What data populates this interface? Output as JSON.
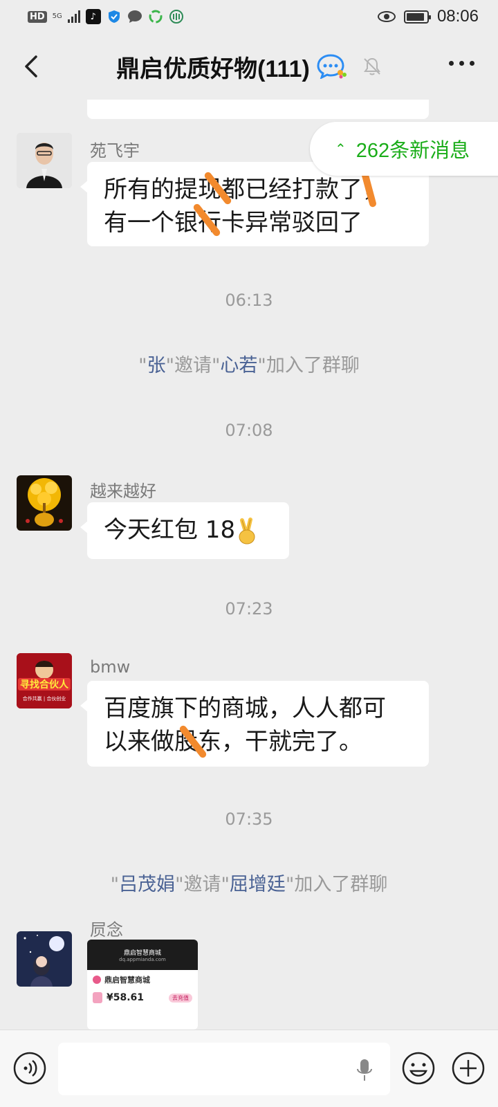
{
  "status_bar": {
    "left_label": "HD",
    "network": "5G",
    "time": "08:06",
    "battery_level": 0.9,
    "icons": [
      "tiktok-icon",
      "shield-icon",
      "message-icon",
      "recycle-icon",
      "bank-icon"
    ]
  },
  "header": {
    "title": "鼎启优质好物(111)",
    "icons": [
      "back-icon",
      "group-badge-icon",
      "mute-bell-icon",
      "more-icon"
    ]
  },
  "new_messages": {
    "label": "262条新消息"
  },
  "messages": [
    {
      "type": "text",
      "sender": "",
      "text": "…",
      "cut": true
    },
    {
      "type": "text",
      "sender": "苑飞宇",
      "lines": [
        "所有的提现都已经打款了，",
        "有一个银行卡异常驳回了"
      ]
    },
    {
      "type": "time",
      "text": "06:13"
    },
    {
      "type": "system",
      "parts": [
        "\"",
        "张",
        "\"邀请\"",
        "心若",
        "\"加入了群聊"
      ]
    },
    {
      "type": "time",
      "text": "07:08"
    },
    {
      "type": "text",
      "sender": "越来越好",
      "text": "今天红包 18",
      "emoji": "victory-hand-emoji"
    },
    {
      "type": "time",
      "text": "07:23"
    },
    {
      "type": "text",
      "sender": "bmw",
      "lines": [
        "百度旗下的商城，人人都可",
        "以来做股东，干就完了。"
      ]
    },
    {
      "type": "time",
      "text": "07:35"
    },
    {
      "type": "system",
      "parts": [
        "\"",
        "吕茂娟",
        "\"邀请\"",
        "屈增廷",
        "\"加入了群聊"
      ]
    },
    {
      "type": "image",
      "sender": "屃念",
      "preview": {
        "app_title": "鼎启智慧商城",
        "url": "dq.appmianda.com",
        "shop_name": "鼎启智慧商城",
        "amount": "¥58.61",
        "button": "去充值"
      }
    }
  ],
  "avatars": {
    "avatar_1_label": "",
    "avatar_3_text": "寻找合伙人",
    "avatar_3_sub": "合作共赢 | 合伙创业"
  },
  "colors": {
    "background": "#ededed",
    "bubble": "#ffffff",
    "accent_green": "#1aad19",
    "name_link": "#4a6294",
    "annotation_orange": "#f28a2e"
  }
}
